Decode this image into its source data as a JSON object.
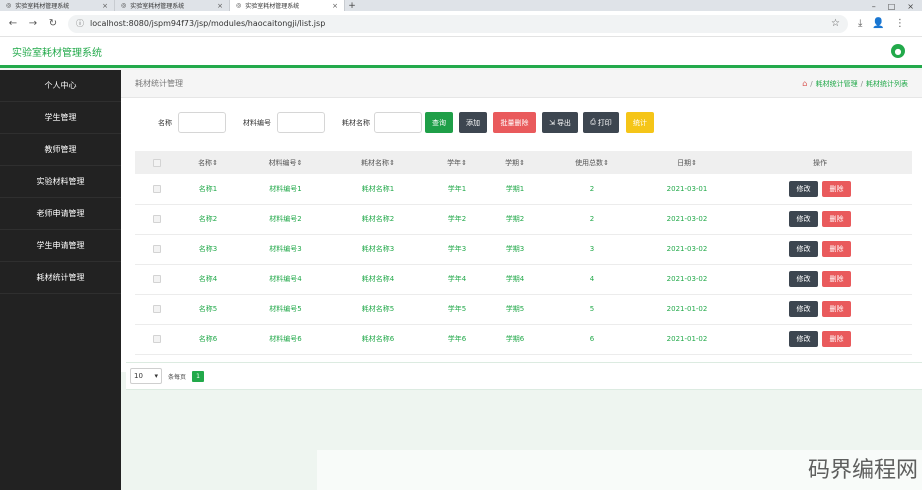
{
  "browser": {
    "tabs": [
      {
        "title": "实验室耗材管理系统"
      },
      {
        "title": "实验室耗材管理系统"
      },
      {
        "title": "实验室耗材管理系统"
      }
    ],
    "url": "localhost:8080/jspm94f73/jsp/modules/haocaitongji/list.jsp"
  },
  "app": {
    "title": "实验室耗材管理系统"
  },
  "sidebar": {
    "items": [
      {
        "label": "个人中心"
      },
      {
        "label": "学生管理"
      },
      {
        "label": "教师管理"
      },
      {
        "label": "实验材料管理"
      },
      {
        "label": "老师申请管理"
      },
      {
        "label": "学生申请管理"
      },
      {
        "label": "耗材统计管理"
      }
    ]
  },
  "breadcrumb": {
    "page_title": "耗材统计管理",
    "items": [
      "耗材统计管理",
      "耗材统计列表"
    ]
  },
  "search": {
    "name_label": "名称",
    "code_label": "材料编号",
    "material_label": "耗材名称",
    "buttons": {
      "query": "查询",
      "add": "添加",
      "batch_delete": "批量删除",
      "export": "导出",
      "print": "打印",
      "stats": "统计"
    }
  },
  "table": {
    "headers": [
      "名称",
      "材料编号",
      "耗材名称",
      "学年",
      "学期",
      "使用总数",
      "日期",
      "操作"
    ],
    "rows": [
      {
        "name": "名称1",
        "code": "材料编号1",
        "material": "耗材名称1",
        "year": "学年1",
        "term": "学期1",
        "total": "2",
        "date": "2021-03-01"
      },
      {
        "name": "名称2",
        "code": "材料编号2",
        "material": "耗材名称2",
        "year": "学年2",
        "term": "学期2",
        "total": "2",
        "date": "2021-03-02"
      },
      {
        "name": "名称3",
        "code": "材料编号3",
        "material": "耗材名称3",
        "year": "学年3",
        "term": "学期3",
        "total": "3",
        "date": "2021-03-02"
      },
      {
        "name": "名称4",
        "code": "材料编号4",
        "material": "耗材名称4",
        "year": "学年4",
        "term": "学期4",
        "total": "4",
        "date": "2021-03-02"
      },
      {
        "name": "名称5",
        "code": "材料编号5",
        "material": "耗材名称5",
        "year": "学年5",
        "term": "学期5",
        "total": "5",
        "date": "2021-01-02"
      },
      {
        "name": "名称6",
        "code": "材料编号6",
        "material": "耗材名称6",
        "year": "学年6",
        "term": "学期6",
        "total": "6",
        "date": "2021-01-02"
      }
    ],
    "edit_label": "修改",
    "delete_label": "删除"
  },
  "pager": {
    "page_size": "10",
    "per_page_label": "条每页",
    "current_page": "1"
  },
  "watermark": "码界编程网",
  "colors": {
    "accent": "#22a94a",
    "sidebar_bg": "#222222",
    "danger": "#e95a5c",
    "dark_button": "#3d4650",
    "warning": "#f5c518"
  }
}
